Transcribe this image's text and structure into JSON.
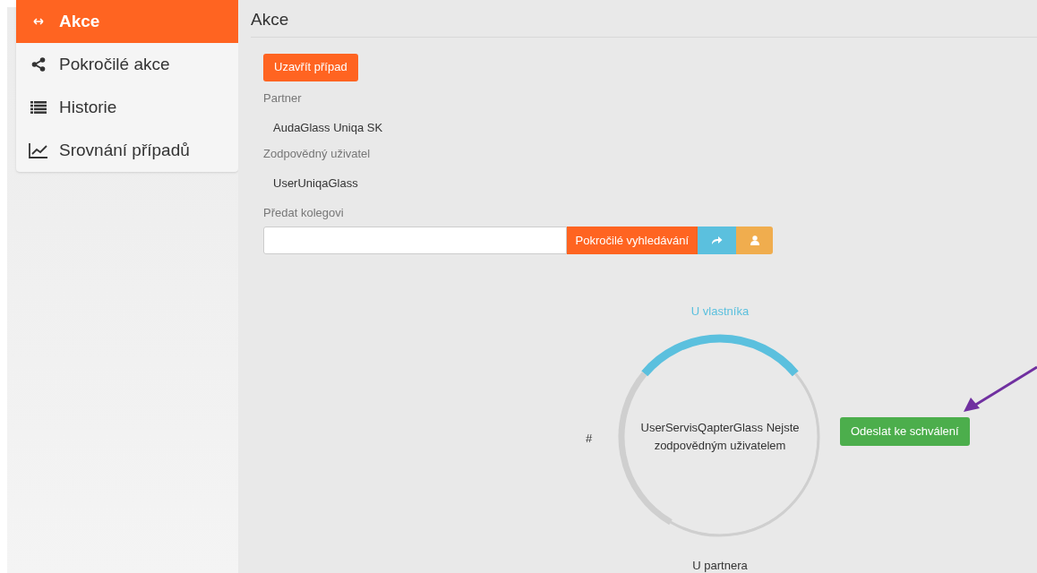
{
  "sidebar": {
    "items": [
      {
        "label": "Akce",
        "selected": true
      },
      {
        "label": "Pokročilé akce",
        "selected": false
      },
      {
        "label": "Historie",
        "selected": false
      },
      {
        "label": "Srovnání případů",
        "selected": false
      }
    ]
  },
  "main": {
    "title": "Akce",
    "close_button": "Uzavřít případ",
    "fields": [
      {
        "label": "Partner",
        "value": "AudaGlass Uniqa SK"
      },
      {
        "label": "Zodpovědný uživatel",
        "value": "UserUniqaGlass"
      }
    ],
    "handover": {
      "label": "Předat kolegovi",
      "search_button": "Pokročilé vyhledávání"
    },
    "workflow": {
      "stages": [
        {
          "label": "U vlastníka",
          "active": true
        },
        {
          "label": "#",
          "active": false
        },
        {
          "label": "U partnera",
          "active": false
        }
      ],
      "center_text": "UserServisQapterGlass Nejste zodpovědným uživatelem",
      "submit_button": "Odeslat ke schválení"
    }
  }
}
